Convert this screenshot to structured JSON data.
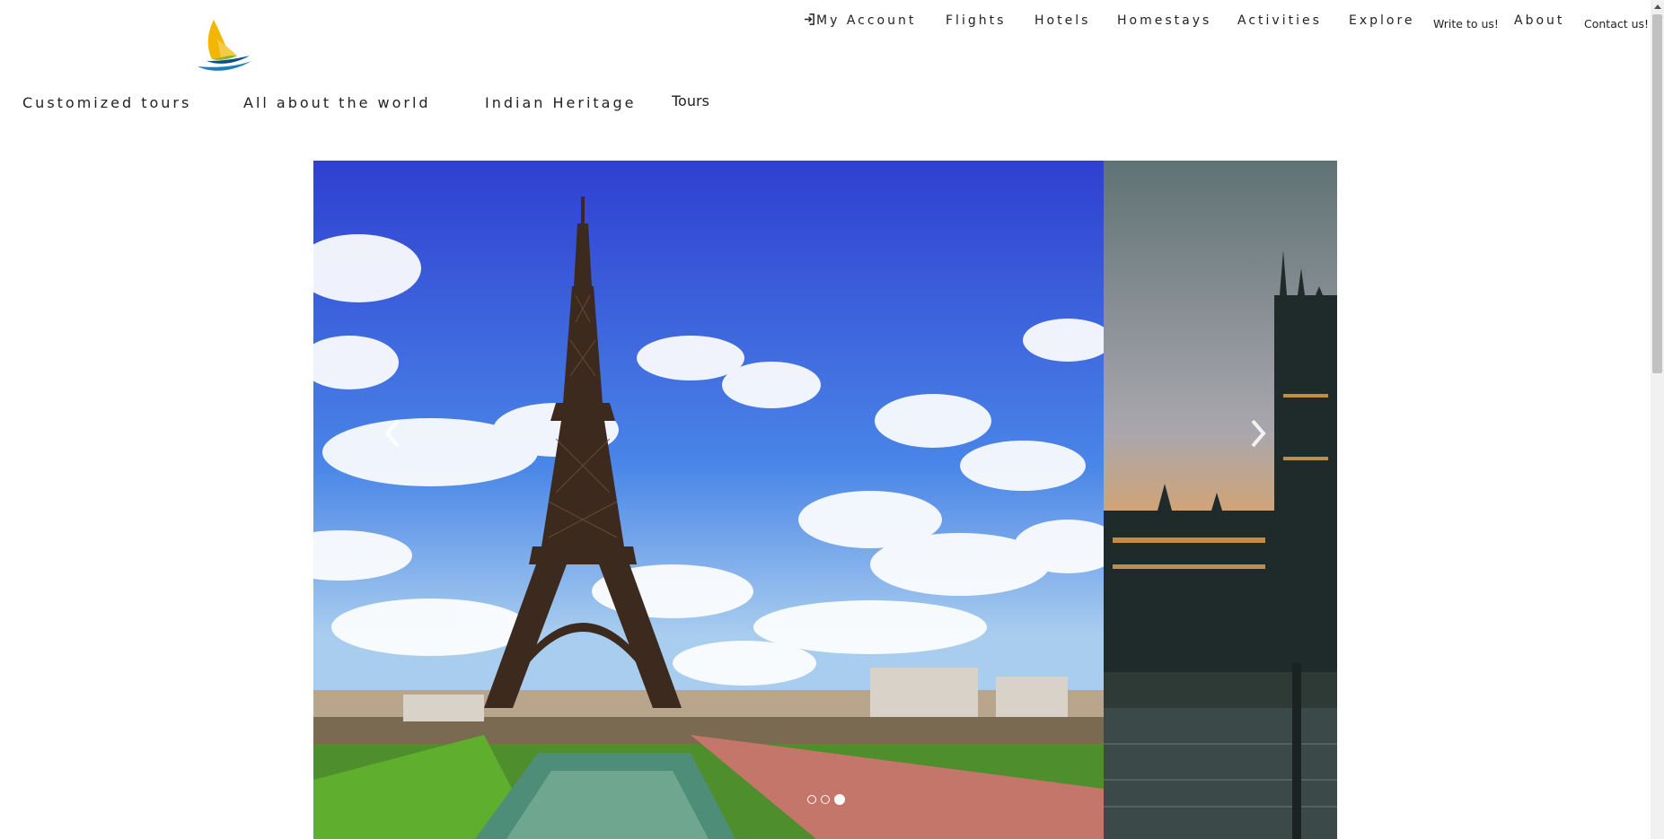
{
  "brand": {
    "logo_icon": "sailboat-logo-icon",
    "colors": [
      "#f2b705",
      "#1a7ec2",
      "#0d4d8b",
      "#8bb31d"
    ]
  },
  "top_nav": {
    "my_account": "My Account",
    "flights": "Flights",
    "hotels": "Hotels",
    "homestays": "Homestays",
    "activities": "Activities",
    "explore": "Explore",
    "write_to_us": "Write to us!",
    "about": "About",
    "contact_us": "Contact us!"
  },
  "category_nav": {
    "customized_tours": "Customized tours",
    "all_about_world": "All about the world",
    "indian_heritage": "Indian Heritage",
    "tours": "Tours"
  },
  "carousel": {
    "slides": [
      {
        "icon": "eiffel-tower-image"
      },
      {
        "icon": "westminster-palace-image"
      }
    ],
    "indicators": 3,
    "active_indicator": 3,
    "prev_icon": "chevron-left-icon",
    "next_icon": "chevron-right-icon"
  }
}
